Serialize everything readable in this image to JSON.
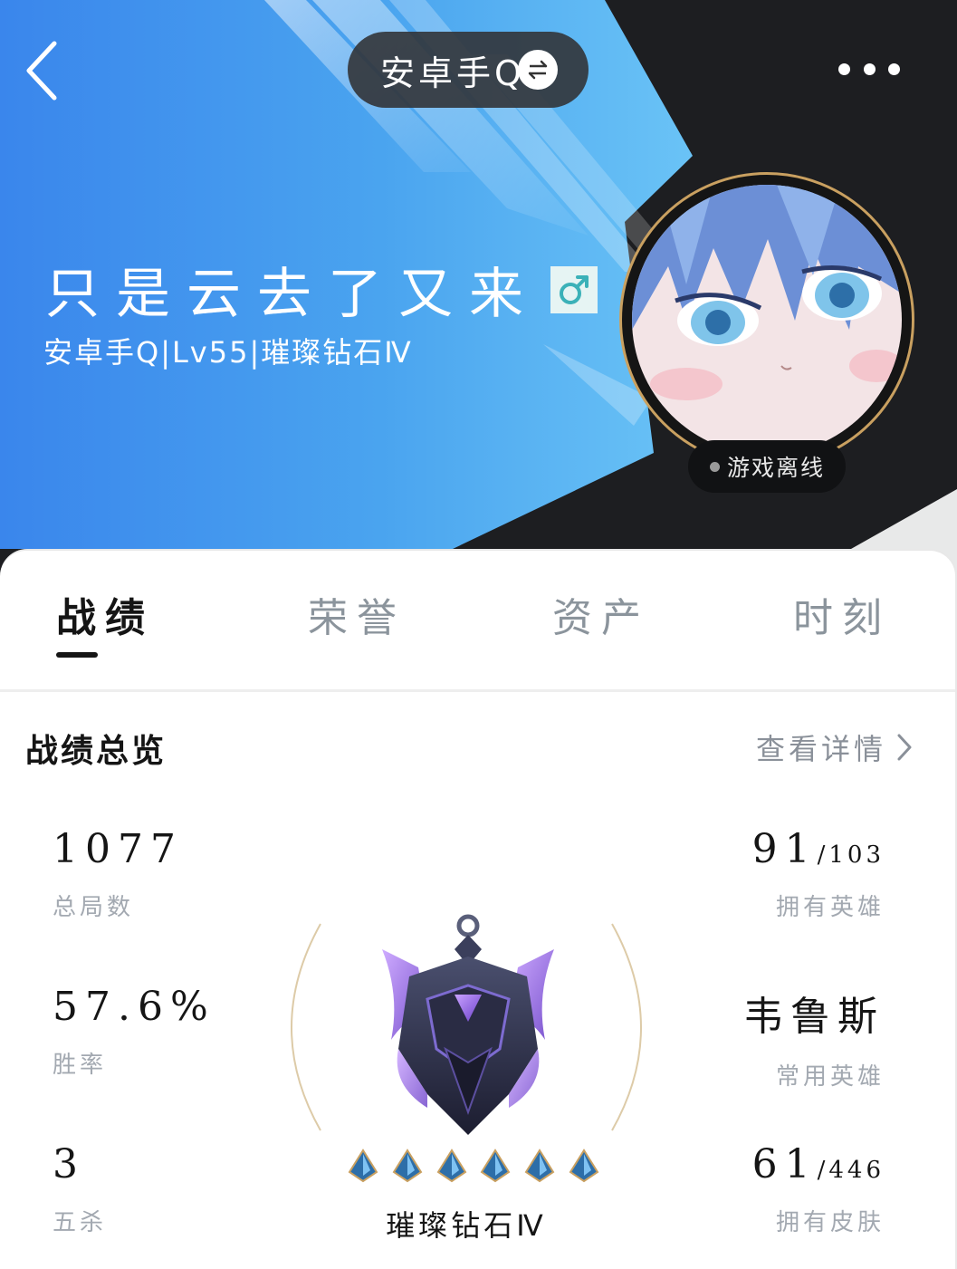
{
  "header": {
    "server_label": "安卓手Q",
    "nickname": "只是云去了又来",
    "gender": "male",
    "subinfo": "安卓手Q|Lv55|璀璨钻石Ⅳ",
    "status": "游戏离线",
    "icons": [
      "back-arrow-icon",
      "swap-icon",
      "more-icon",
      "male-icon"
    ]
  },
  "tabs": [
    {
      "label": "战绩",
      "active": true
    },
    {
      "label": "荣誉",
      "active": false
    },
    {
      "label": "资产",
      "active": false
    },
    {
      "label": "时刻",
      "active": false
    }
  ],
  "overview": {
    "title": "战绩总览",
    "detail_link": "查看详情",
    "total_games": {
      "value": "1077",
      "label": "总局数"
    },
    "win_rate": {
      "value": "57.6%",
      "label": "胜率"
    },
    "penta_kills": {
      "value": "3",
      "label": "五杀"
    },
    "owned_heroes": {
      "value": "91",
      "total": "/103",
      "label": "拥有英雄"
    },
    "main_hero": {
      "value": "韦鲁斯",
      "label": "常用英雄"
    },
    "owned_skins": {
      "value": "61",
      "total": "/446",
      "label": "拥有皮肤"
    },
    "rank": {
      "name": "璀璨钻石Ⅳ",
      "stars": 6
    }
  },
  "colors": {
    "accent_blue": "#3f8ef0",
    "banner_dark": "#1d1e21",
    "ring_gold": "#c9a060",
    "muted_text": "#a3a9b1"
  }
}
